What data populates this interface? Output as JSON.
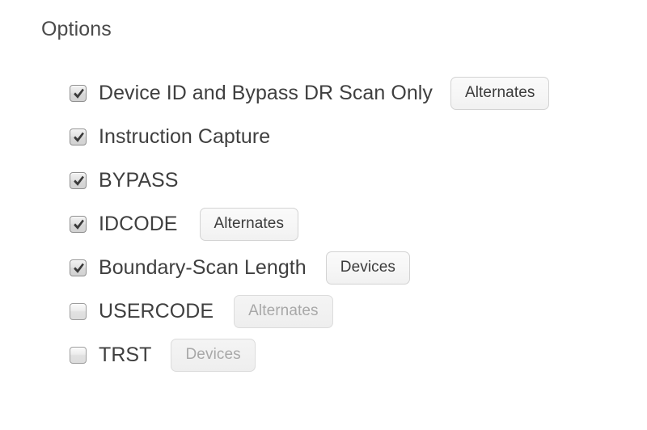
{
  "panel": {
    "group_title": "Options",
    "background_color": "#ffffff",
    "text_color": "#3f3f3f",
    "disabled_text_color": "#a8a8a8"
  },
  "options": [
    {
      "id": "device-id-bypass-dr-scan-only",
      "label": "Device ID and Bypass DR Scan Only",
      "checked": true,
      "checkbox_state": "checked",
      "button": {
        "label": "Alternates",
        "enabled": true
      }
    },
    {
      "id": "instruction-capture",
      "label": "Instruction Capture",
      "checked": true,
      "checkbox_state": "checked",
      "button": null
    },
    {
      "id": "bypass",
      "label": "BYPASS",
      "checked": true,
      "checkbox_state": "checked",
      "button": null
    },
    {
      "id": "idcode",
      "label": "IDCODE",
      "checked": true,
      "checkbox_state": "checked",
      "button": {
        "label": "Alternates",
        "enabled": true
      }
    },
    {
      "id": "boundary-scan-length",
      "label": "Boundary-Scan Length",
      "checked": true,
      "checkbox_state": "checked",
      "button": {
        "label": "Devices",
        "enabled": true
      }
    },
    {
      "id": "usercode",
      "label": "USERCODE",
      "checked": false,
      "checkbox_state": "unchecked",
      "button": {
        "label": "Alternates",
        "enabled": false
      }
    },
    {
      "id": "trst",
      "label": "TRST",
      "checked": false,
      "checkbox_state": "unchecked",
      "button": {
        "label": "Devices",
        "enabled": false
      }
    }
  ],
  "icons": {
    "checkmark": "check-icon"
  }
}
